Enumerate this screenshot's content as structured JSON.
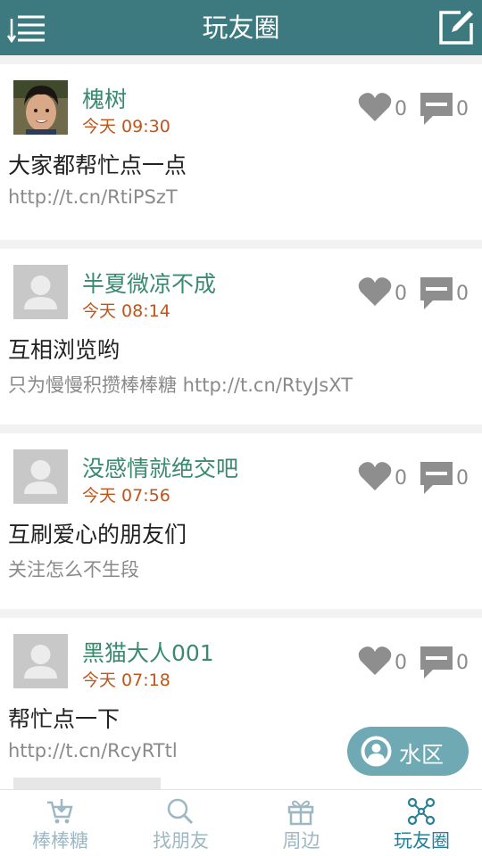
{
  "header": {
    "title": "玩友圈"
  },
  "posts": [
    {
      "username": "槐树",
      "time": "今天 09:30",
      "likes": "0",
      "comments": "0",
      "content": "大家都帮忙点一点",
      "link": "http://t.cn/RtiPSzT",
      "has_photo": true
    },
    {
      "username": "半夏微凉不成",
      "time": "今天 08:14",
      "likes": "0",
      "comments": "0",
      "content": "互相浏览哟",
      "link": "只为慢慢积攒棒棒糖 http://t.cn/RtyJsXT",
      "has_photo": false
    },
    {
      "username": "没感情就绝交吧",
      "time": "今天 07:56",
      "likes": "0",
      "comments": "0",
      "content": "互刷爱心的朋友们",
      "link": "关注怎么不生段",
      "has_photo": false
    },
    {
      "username": "黑猫大人001",
      "time": "今天 07:18",
      "likes": "0",
      "comments": "0",
      "content": "帮忙点一下",
      "link": "http://t.cn/RcyRTtl",
      "has_photo": false
    }
  ],
  "floating_button": {
    "label": "水区",
    "icon": "user-circle-icon"
  },
  "bottom_nav": {
    "items": [
      {
        "label": "棒棒糖",
        "icon": "cart-icon",
        "active": false
      },
      {
        "label": "找朋友",
        "icon": "search-icon",
        "active": false
      },
      {
        "label": "周边",
        "icon": "gift-icon",
        "active": false
      },
      {
        "label": "玩友圈",
        "icon": "network-icon",
        "active": true
      }
    ]
  },
  "colors": {
    "header_bg": "#3c7a80",
    "username": "#3a8a6e",
    "time": "#c0541b",
    "nav_active": "#2a7f98",
    "nav_inactive": "#9eb8c3",
    "floating_bg": "#6fa9b4"
  }
}
